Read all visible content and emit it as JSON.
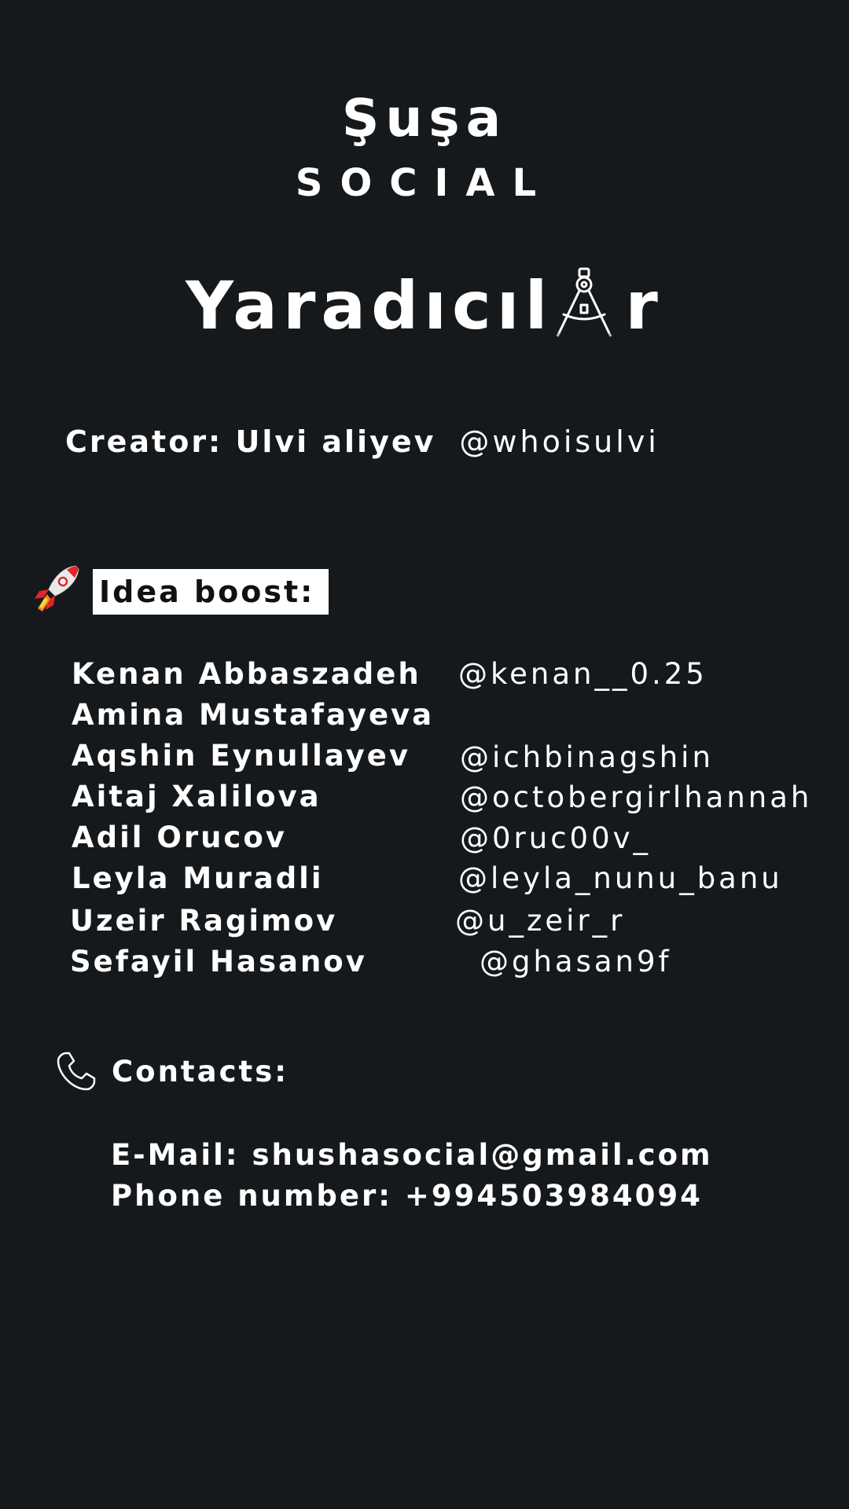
{
  "logo": {
    "wordmark": "Şuşa",
    "sub": "SOCIAL"
  },
  "heading": {
    "before": "Yaradıcıl",
    "after": "r",
    "icon": "compass-icon"
  },
  "creator": {
    "label": "Creator: Ulvi aliyev",
    "handle": "@whoisulvi"
  },
  "idea_boost": {
    "icon": "rocket-icon",
    "label": "Idea boost:"
  },
  "people": [
    {
      "name": "Kenan Abbaszadeh",
      "handle": "@kenan__0.25"
    },
    {
      "name": "Amina Mustafayeva",
      "handle": ""
    },
    {
      "name": "Aqshin Eynullayev",
      "handle": "@ichbinagshin"
    },
    {
      "name": "Aitaj Xalilova",
      "handle": "@octobergirlhannah"
    },
    {
      "name": "Adil Orucov",
      "handle": "@0ruc00v_"
    },
    {
      "name": "Leyla Muradli",
      "handle": "@leyla_nunu_banu"
    },
    {
      "name": "Uzeir Ragimov",
      "handle": "@u_zeir_r"
    },
    {
      "name": "Sefayil Hasanov",
      "handle": "@ghasan9f"
    }
  ],
  "contacts": {
    "icon": "phone-icon",
    "label": "Contacts:",
    "email": "E-Mail: shushasocial@gmail.com",
    "phone": "Phone number: +994503984094"
  },
  "colors": {
    "background": "#16191c",
    "text": "#ffffff",
    "rocket_red": "#e0262b"
  }
}
